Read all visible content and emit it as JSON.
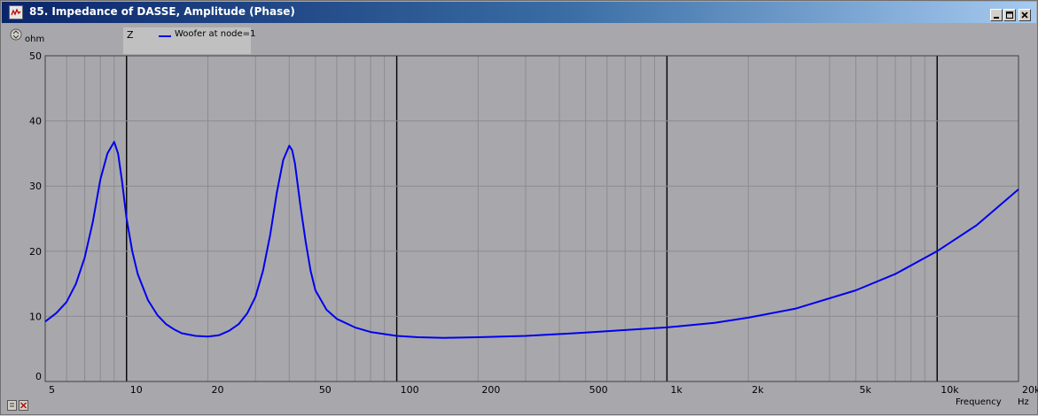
{
  "window": {
    "title": "85. Impedance of DASSE, Amplitude (Phase)",
    "controls": [
      "minimize",
      "maximize",
      "close"
    ]
  },
  "legend": {
    "group_label": "Z",
    "entries": [
      {
        "label": "Woofer at node=1",
        "color": "#0000ee"
      }
    ]
  },
  "axes": {
    "y_unit": "ohm",
    "x_title": "Frequency",
    "x_unit": "Hz"
  },
  "chart_data": {
    "type": "line",
    "title": "85. Impedance of DASSE, Amplitude (Phase)",
    "xlabel": "Frequency",
    "xunit": "Hz",
    "ylabel": "ohm",
    "xscale": "log",
    "xlim": [
      5,
      20000
    ],
    "ylim": [
      0,
      50
    ],
    "grid": true,
    "legend_position": "top-left",
    "x_ticks": [
      {
        "value": 5,
        "label": "5"
      },
      {
        "value": 10,
        "label": "10"
      },
      {
        "value": 20,
        "label": "20"
      },
      {
        "value": 50,
        "label": "50"
      },
      {
        "value": 100,
        "label": "100"
      },
      {
        "value": 200,
        "label": "200"
      },
      {
        "value": 500,
        "label": "500"
      },
      {
        "value": 1000,
        "label": "1k"
      },
      {
        "value": 2000,
        "label": "2k"
      },
      {
        "value": 5000,
        "label": "5k"
      },
      {
        "value": 10000,
        "label": "10k"
      },
      {
        "value": 20000,
        "label": "20k"
      }
    ],
    "y_ticks": [
      0,
      10,
      20,
      30,
      40,
      50
    ],
    "series": [
      {
        "name": "Woofer at node=1",
        "color": "#0000ee",
        "x": [
          5,
          5.5,
          6,
          6.5,
          7,
          7.5,
          8,
          8.5,
          9,
          9.3,
          9.6,
          10,
          10.5,
          11,
          12,
          13,
          14,
          15,
          16,
          18,
          20,
          22,
          24,
          26,
          28,
          30,
          32,
          34,
          36,
          38,
          40,
          41,
          42,
          44,
          46,
          48,
          50,
          55,
          60,
          70,
          80,
          100,
          120,
          150,
          200,
          300,
          500,
          700,
          1000,
          1500,
          2000,
          3000,
          5000,
          7000,
          10000,
          14000,
          20000
        ],
        "y": [
          9.2,
          10.5,
          12.2,
          15.0,
          19.0,
          24.5,
          31.0,
          35.0,
          36.8,
          35.0,
          31.0,
          25.0,
          20.0,
          16.5,
          12.5,
          10.2,
          8.8,
          8.0,
          7.4,
          7.0,
          6.9,
          7.1,
          7.8,
          8.8,
          10.5,
          13.0,
          17.0,
          22.5,
          29.0,
          34.0,
          36.2,
          35.5,
          33.5,
          27.0,
          21.5,
          17.0,
          14.0,
          11.0,
          9.6,
          8.3,
          7.6,
          7.0,
          6.8,
          6.7,
          6.8,
          7.0,
          7.5,
          7.9,
          8.3,
          9.0,
          9.8,
          11.2,
          14.0,
          16.5,
          20.0,
          24.0,
          29.5
        ]
      }
    ]
  }
}
